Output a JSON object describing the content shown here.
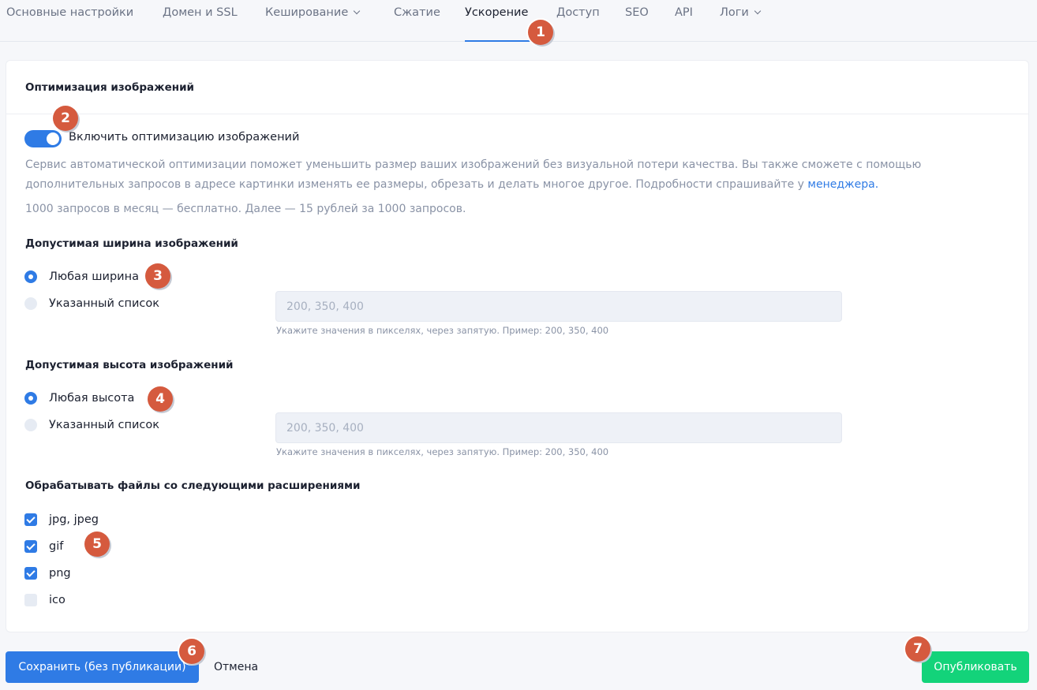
{
  "tabs": [
    {
      "label": "Основные настройки",
      "has_dropdown": false,
      "active": false
    },
    {
      "label": "Домен и SSL",
      "has_dropdown": false,
      "active": false
    },
    {
      "label": "Кеширование",
      "has_dropdown": true,
      "active": false
    },
    {
      "label": "Сжатие",
      "has_dropdown": false,
      "active": false
    },
    {
      "label": "Ускорение",
      "has_dropdown": false,
      "active": true
    },
    {
      "label": "Доступ",
      "has_dropdown": false,
      "active": false
    },
    {
      "label": "SEO",
      "has_dropdown": false,
      "active": false
    },
    {
      "label": "API",
      "has_dropdown": false,
      "active": false
    },
    {
      "label": "Логи",
      "has_dropdown": true,
      "active": false
    }
  ],
  "card": {
    "title": "Оптимизация изображений",
    "toggle": {
      "label": "Включить оптимизацию изображений",
      "enabled": true
    },
    "description_1": "Сервис автоматической оптимизации поможет уменьшить размер ваших изображений без визуальной потери качества. Вы также сможете с помощью дополнительных запросов в адресе картинки изменять ее размеры, обрезать и делать многое другое. Подробности спрашивайте у",
    "description_link": "менеджера.",
    "pricing": "1000 запросов в месяц — бесплатно. Далее — 15 рублей за 1000 запросов."
  },
  "width_section": {
    "title": "Допустимая ширина изображений",
    "options": [
      {
        "label": "Любая ширина",
        "checked": true
      },
      {
        "label": "Указанный список",
        "checked": false
      }
    ],
    "input_value": "",
    "input_placeholder": "200, 350, 400",
    "hint": "Укажите значения в пикселях, через запятую. Пример: 200, 350, 400"
  },
  "height_section": {
    "title": "Допустимая высота изображений",
    "options": [
      {
        "label": "Любая высота",
        "checked": true
      },
      {
        "label": "Указанный список",
        "checked": false
      }
    ],
    "input_value": "",
    "input_placeholder": "200, 350, 400",
    "hint": "Укажите значения в пикселях, через запятую. Пример: 200, 350, 400"
  },
  "extensions_section": {
    "title": "Обрабатывать файлы со следующими расширениями",
    "options": [
      {
        "label": "jpg, jpeg",
        "checked": true
      },
      {
        "label": "gif",
        "checked": true
      },
      {
        "label": "png",
        "checked": true
      },
      {
        "label": "ico",
        "checked": false
      }
    ]
  },
  "footer": {
    "save_label": "Сохранить (без публикации)",
    "cancel_label": "Отмена",
    "publish_label": "Опубликовать"
  },
  "markers": [
    "1",
    "2",
    "3",
    "4",
    "5",
    "6",
    "7"
  ],
  "colors": {
    "accent": "#2f7be5",
    "publish": "#13d37a",
    "marker": "#d55a3e",
    "muted_text": "#8a93a6"
  }
}
